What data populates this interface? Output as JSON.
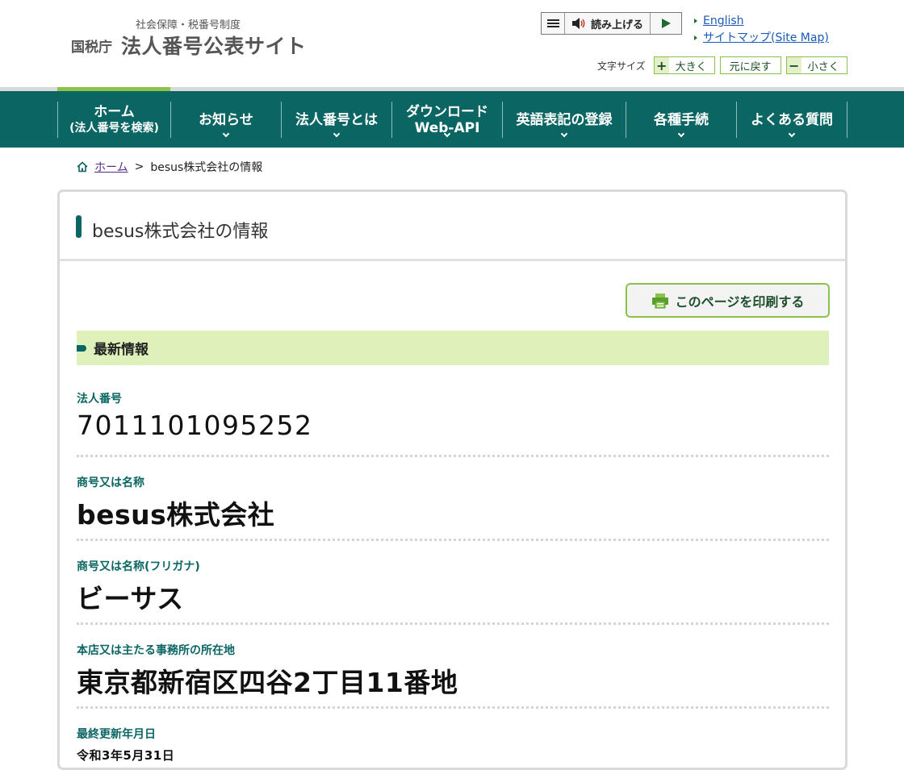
{
  "header": {
    "logo_sub": "社会保障・税番号制度",
    "logo_agency": "国税庁",
    "logo_title": "法人番号公表サイト",
    "read_aloud_label": "読み上げる",
    "links": [
      "English",
      "サイトマップ(Site Map)"
    ],
    "font_size_label": "文字サイズ",
    "font_bigger": "大きく",
    "font_reset": "元に戻す",
    "font_smaller": "小さく"
  },
  "nav": {
    "items": [
      {
        "line1": "ホーム",
        "line2": "(法人番号を検索)"
      },
      {
        "line1": "お知らせ"
      },
      {
        "line1": "法人番号とは"
      },
      {
        "line1": "ダウンロード",
        "line2": "Web-API"
      },
      {
        "line1": "英語表記の登録"
      },
      {
        "line1": "各種手続"
      },
      {
        "line1": "よくある質問"
      }
    ]
  },
  "breadcrumb": {
    "home": "ホーム",
    "separator": ">",
    "current": "besus株式会社の情報"
  },
  "main": {
    "title": "besus株式会社の情報",
    "print_label": "このページを印刷する",
    "section_title": "最新情報",
    "fields": [
      {
        "label": "法人番号",
        "value": "7011101095252"
      },
      {
        "label": "商号又は名称",
        "value": "besus株式会社"
      },
      {
        "label": "商号又は名称(フリガナ)",
        "value": "ビーサス"
      },
      {
        "label": "本店又は主たる事務所の所在地",
        "value": "東京都新宿区四谷2丁目11番地"
      },
      {
        "label": "最終更新年月日",
        "value": "令和3年5月31日"
      }
    ]
  },
  "colors": {
    "brand_green": "#0b6663",
    "accent_lime": "#8bc34a",
    "section_bg": "#dff1bb",
    "link_blue": "#1a5ab8"
  }
}
